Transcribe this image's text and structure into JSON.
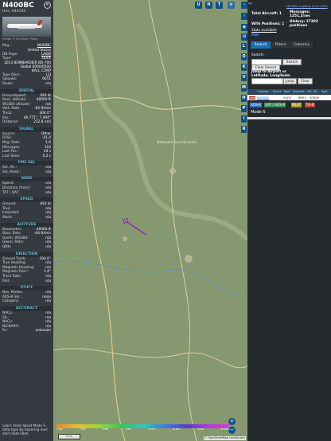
{
  "aircraft": {
    "callsign": "N400BC",
    "hex": "Hex: A44C80",
    "photo_credit": "Image © Christoph Plank",
    "reg_label": "Reg.:",
    "reg": "N400BC",
    "country": "United States",
    "dbflags_label": "DB flags:",
    "dbflags": "LADD",
    "type_label": "Type:",
    "type": "GLEX",
    "description": "2013 BOMBARDIER BD-700 Global 6000/6500",
    "operator": "BALL CORP",
    "typedesc_label": "Type Desc.:",
    "typedesc": "L2J",
    "squawk_label": "Squawk:",
    "squawk": "6651",
    "route_label": "Route:",
    "route": "n/a"
  },
  "sections": {
    "spatial": "SPATIAL",
    "signal": "SIGNAL",
    "fms": "FMS SEL",
    "wind": "WIND",
    "speed": "SPEED",
    "altitude": "ALTITUDE",
    "direction": "DIRECTION",
    "stuff": "STUFF",
    "accuracy": "ACCURACY"
  },
  "spatial": [
    {
      "k": "Groundspeed:",
      "v": "493 kt"
    },
    {
      "k": "Baro. altitude:",
      "v": "40000 ft"
    },
    {
      "k": "WGS84 altitude:",
      "v": "n/a"
    },
    {
      "k": "Vert. Rate:",
      "v": "-64 ft/min"
    },
    {
      "k": "Track:",
      "v": "304.0°"
    },
    {
      "k": "Pos.:",
      "v": "49.771°, 7.494°"
    },
    {
      "k": "Distance:",
      "v": "212.8 nmi"
    }
  ],
  "signal": [
    {
      "k": "Source:",
      "v": "Other"
    },
    {
      "k": "RSSI:",
      "v": "-41.4"
    },
    {
      "k": "Msg. Rate:",
      "v": "1.6"
    },
    {
      "k": "Messages:",
      "v": "103"
    },
    {
      "k": "Last Pos.:",
      "v": "24 s"
    },
    {
      "k": "Last Seen:",
      "v": "0.2 s"
    }
  ],
  "fms": [
    {
      "k": "Sel. Alt.:",
      "v": "n/a"
    },
    {
      "k": "Sel. Head.:",
      "v": "n/a"
    }
  ],
  "wind": [
    {
      "k": "Speed:",
      "v": "n/a"
    },
    {
      "k": "Direction (from):",
      "v": "n/a"
    },
    {
      "k": "TAT / OAT:",
      "v": "n/a"
    }
  ],
  "speed": [
    {
      "k": "Ground:",
      "v": "493 kt"
    },
    {
      "k": "True:",
      "v": "n/a"
    },
    {
      "k": "Indicated:",
      "v": "n/a"
    },
    {
      "k": "Mach:",
      "v": "n/a"
    }
  ],
  "altitude": [
    {
      "k": "Barometric:",
      "v": "40000 ft"
    },
    {
      "k": "Baro. Rate:",
      "v": "-64 ft/min"
    },
    {
      "k": "Geom. WGS84:",
      "v": "n/a"
    },
    {
      "k": "Geom. Rate:",
      "v": "n/a"
    },
    {
      "k": "QNH:",
      "v": "n/a"
    }
  ],
  "direction": [
    {
      "k": "Ground Track:",
      "v": "304.0°"
    },
    {
      "k": "True Heading:",
      "v": "n/a"
    },
    {
      "k": "Magnetic Heading:",
      "v": "n/a"
    },
    {
      "k": "Magnetic Decl.:",
      "v": "1.4°"
    },
    {
      "k": "Track Rate:",
      "v": "n/a"
    },
    {
      "k": "Roll:",
      "v": "n/a"
    }
  ],
  "stuff": [
    {
      "k": "Nav. Modes:",
      "v": "n/a"
    },
    {
      "k": "ADS-B Ver.:",
      "v": "none"
    },
    {
      "k": "Category:",
      "v": "n/a"
    }
  ],
  "accuracy": [
    {
      "k": "NACp:",
      "v": "n/a"
    },
    {
      "k": "SIL:",
      "v": "n/a"
    },
    {
      "k": "NACv:",
      "v": "n/a"
    },
    {
      "k": "NICBARO:",
      "v": "n/a"
    },
    {
      "k": "Rc:",
      "v": "unknown"
    }
  ],
  "footer": "Learn more about Mode S data type by hovering over each data label.",
  "map": {
    "labels": {
      "nature_park": "Naturpark Saar-Hunsrück",
      "scale": "5 nm",
      "attrib": "© OpenStreetMap contributors",
      "plus": "+",
      "minus": "−"
    },
    "alt_scale": [
      "2 000",
      "4 000",
      "6 000",
      "8 000",
      "10 000",
      "20 000",
      "30 000",
      "40 000+"
    ],
    "top_buttons": [
      "U",
      "H",
      "T"
    ],
    "right_buttons": [
      "L",
      "O",
      "K",
      "V",
      "M",
      "H",
      "P",
      "I",
      "R"
    ],
    "route_heading_deg": 304
  },
  "panel": {
    "nav_label": "‹›",
    "github": "tar1090 on github (3.14.1703)",
    "total_aircraft": "Total Aircraft: 1",
    "with_positions": "With Positions: 1",
    "stats_available": "Stats available",
    "messages": "Messages: 1251.2/sec",
    "history": "History: 27302 positions",
    "tabs": [
      "Search",
      "Filters",
      "Columns"
    ],
    "search_label": "Search:",
    "search_btn": "Search",
    "clear_search": "Clear Search",
    "jump_label": "Jump to Airport or Latitude, Longitude:",
    "jump_btn": "Jump",
    "clear_btn": "Clear",
    "columns": [
      "Callsign",
      "Route",
      "Type",
      "Squawk",
      "Alt. (ft)",
      "Spd. (kt)"
    ],
    "row": [
      "N400BC",
      "GLEX",
      "6651",
      "40000"
    ],
    "badges": [
      "ADS-B",
      "UAT / ADS-R",
      "MLAT",
      "TIS-B"
    ],
    "mode_s": "Mode-S"
  },
  "colors": {
    "sidebar": "#343a3f",
    "section_text": "#59b5d8",
    "button_blue": "#0d4f8b",
    "track": "#9b2fae",
    "link": "#9ec5ff"
  }
}
